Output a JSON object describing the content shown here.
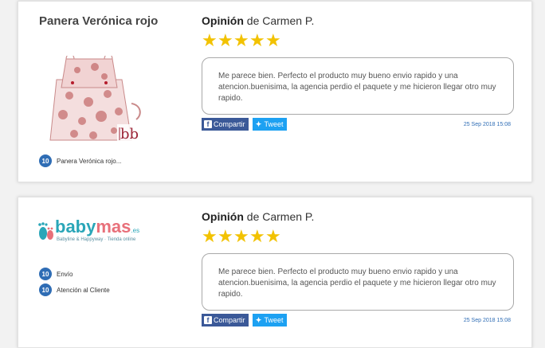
{
  "reviews": [
    {
      "product_title": "Panera Verónica rojo",
      "ratings": [
        {
          "score": "10",
          "label": "Panera Verónica rojo..."
        }
      ],
      "opinion_label": "Opinión",
      "opinion_by": "de Carmen P.",
      "stars": 5,
      "text": "Me parece bien. Perfecto el producto muy bueno envio rapido y una atencion.buenisima, la agencia perdio el paquete y me hicieron llegar otro muy rapido.",
      "share_label": "Compartir",
      "tweet_label": "Tweet",
      "date": "25 Sep 2018 15:08"
    },
    {
      "logo": {
        "part1": "baby",
        "part2": "mas",
        "tld": ".es",
        "tagline": "Babyline & Happyway · Tienda online"
      },
      "ratings": [
        {
          "score": "10",
          "label": "Envío"
        },
        {
          "score": "10",
          "label": "Atención al Cliente"
        }
      ],
      "opinion_label": "Opinión",
      "opinion_by": "de Carmen P.",
      "stars": 5,
      "text": "Me parece bien. Perfecto el producto muy bueno envio rapido y una atencion.buenisima, la agencia perdio el paquete y me hicieron llegar otro muy rapido.",
      "share_label": "Compartir",
      "tweet_label": "Tweet",
      "date": "25 Sep 2018 15:08"
    }
  ],
  "colors": {
    "star": "#f2c200",
    "badge": "#2f6db5",
    "facebook": "#3b5998",
    "twitter": "#1da1f2"
  },
  "icons": {
    "facebook": "facebook-icon",
    "twitter": "twitter-icon",
    "star": "star-icon"
  }
}
